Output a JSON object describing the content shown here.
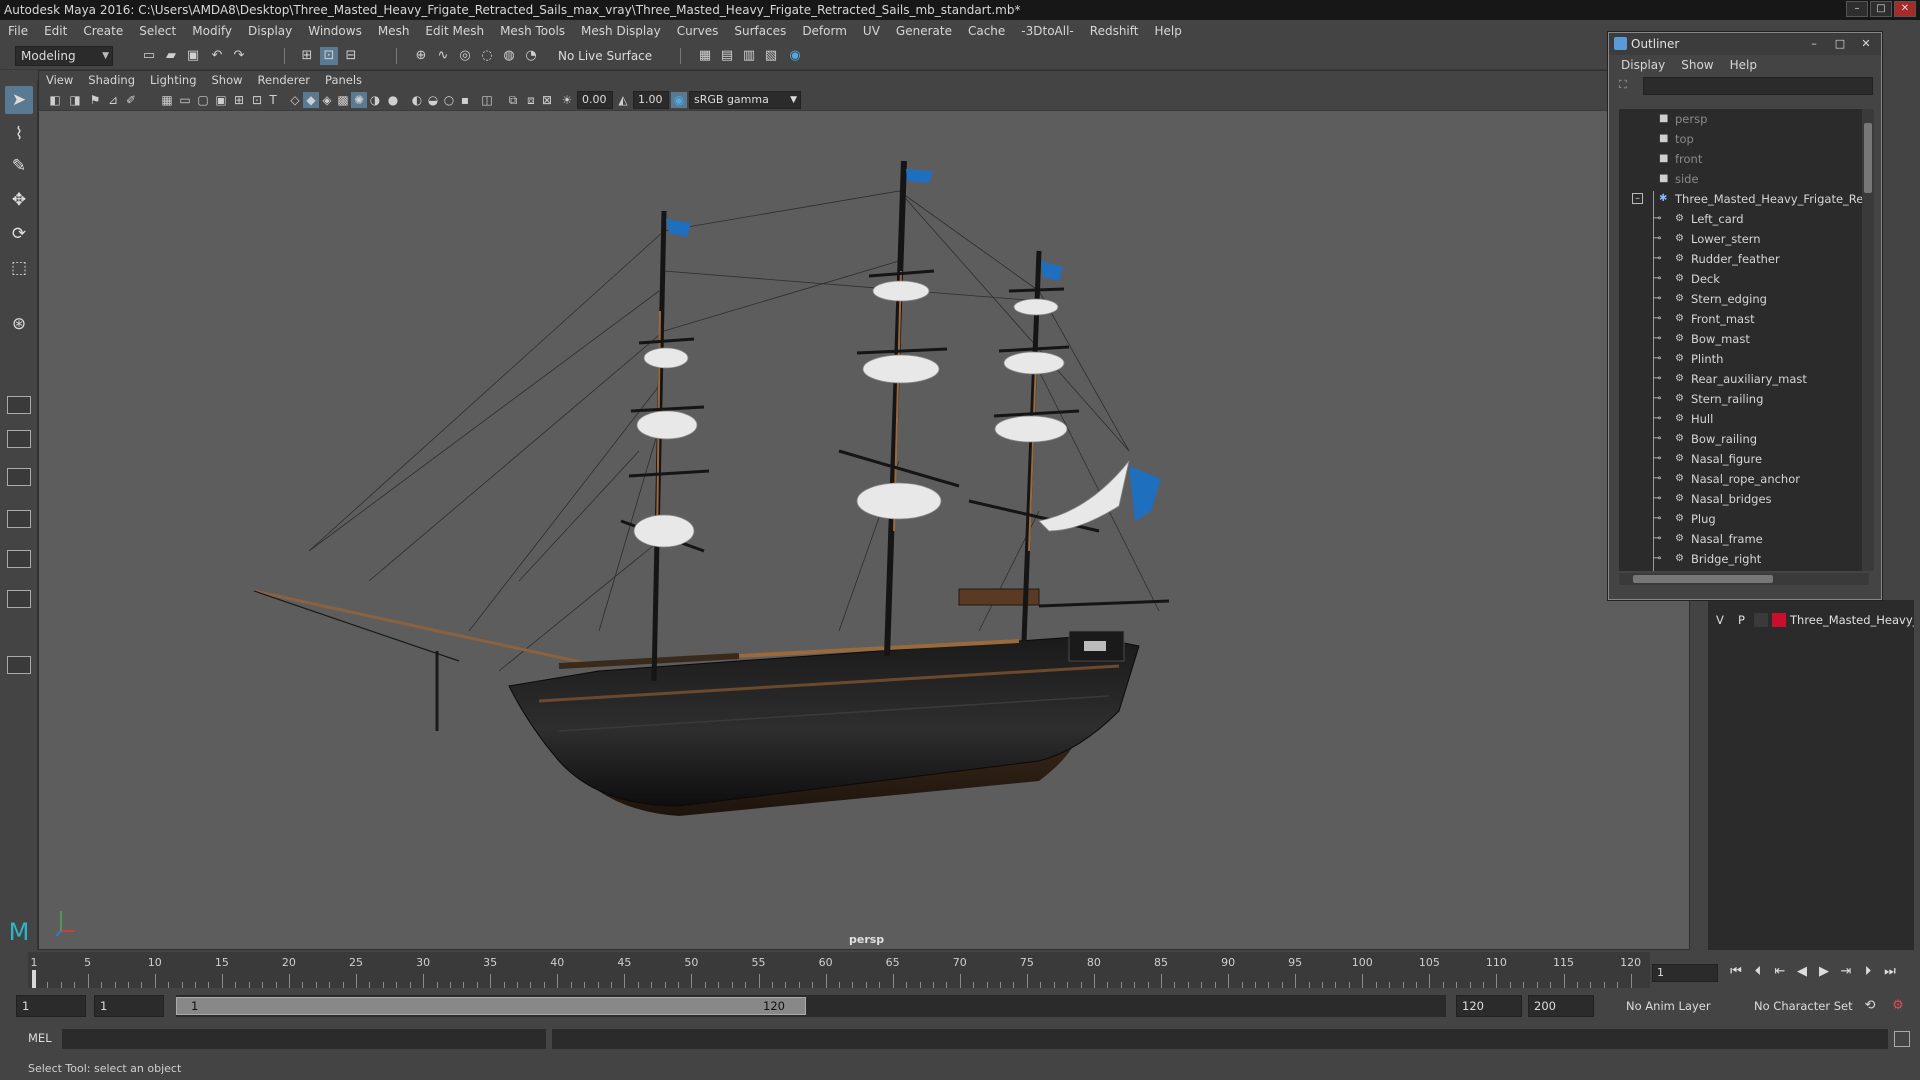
{
  "window": {
    "title": "Autodesk Maya 2016: C:\\Users\\AMDA8\\Desktop\\Three_Masted_Heavy_Frigate_Retracted_Sails_max_vray\\Three_Masted_Heavy_Frigate_Retracted_Sails_mb_standart.mb*"
  },
  "menubar": [
    "File",
    "Edit",
    "Create",
    "Select",
    "Modify",
    "Display",
    "Windows",
    "Mesh",
    "Edit Mesh",
    "Mesh Tools",
    "Mesh Display",
    "Curves",
    "Surfaces",
    "Deform",
    "UV",
    "Generate",
    "Cache",
    "-3DtoAll-",
    "Redshift",
    "Help"
  ],
  "statusline": {
    "mode": "Modeling",
    "live_surface": "No Live Surface"
  },
  "viewport": {
    "panel_menu": [
      "View",
      "Shading",
      "Lighting",
      "Show",
      "Renderer",
      "Panels"
    ],
    "exposure": "0.00",
    "gamma": "1.00",
    "color_space": "sRGB gamma",
    "camera_label": "persp"
  },
  "outliner": {
    "title": "Outliner",
    "menu": [
      "Display",
      "Show",
      "Help"
    ],
    "cameras": [
      "persp",
      "top",
      "front",
      "side"
    ],
    "root": "Three_Masted_Heavy_Frigate_Retra",
    "children": [
      "Left_card",
      "Lower_stern",
      "Rudder_feather",
      "Deck",
      "Stern_edging",
      "Front_mast",
      "Bow_mast",
      "Plinth",
      "Rear_auxiliary_mast",
      "Stern_railing",
      "Hull",
      "Bow_railing",
      "Nasal_figure",
      "Nasal_rope_anchor",
      "Nasal_bridges",
      "Plug",
      "Nasal_frame",
      "Bridge_right"
    ]
  },
  "layer": {
    "visible": "V",
    "playback": "P",
    "name": "Three_Masted_Heavy_F",
    "color": "#c8102e"
  },
  "timeline": {
    "ticks": [
      "1",
      "5",
      "10",
      "15",
      "20",
      "25",
      "30",
      "35",
      "40",
      "45",
      "50",
      "55",
      "60",
      "65",
      "70",
      "75",
      "80",
      "85",
      "90",
      "95",
      "100",
      "105",
      "110",
      "115",
      "120"
    ],
    "current_frame": "1"
  },
  "range": {
    "start": "1",
    "playback_start": "1",
    "slider_start": "1",
    "slider_end": "120",
    "playback_end": "120",
    "end": "200",
    "anim_layer": "No Anim Layer",
    "character_set": "No Character Set"
  },
  "command": {
    "lang": "MEL"
  },
  "help_line": "Select Tool: select an object",
  "colors": {
    "accent": "#5a7a94",
    "flag": "#1f6fbf",
    "hull": "#141414"
  }
}
